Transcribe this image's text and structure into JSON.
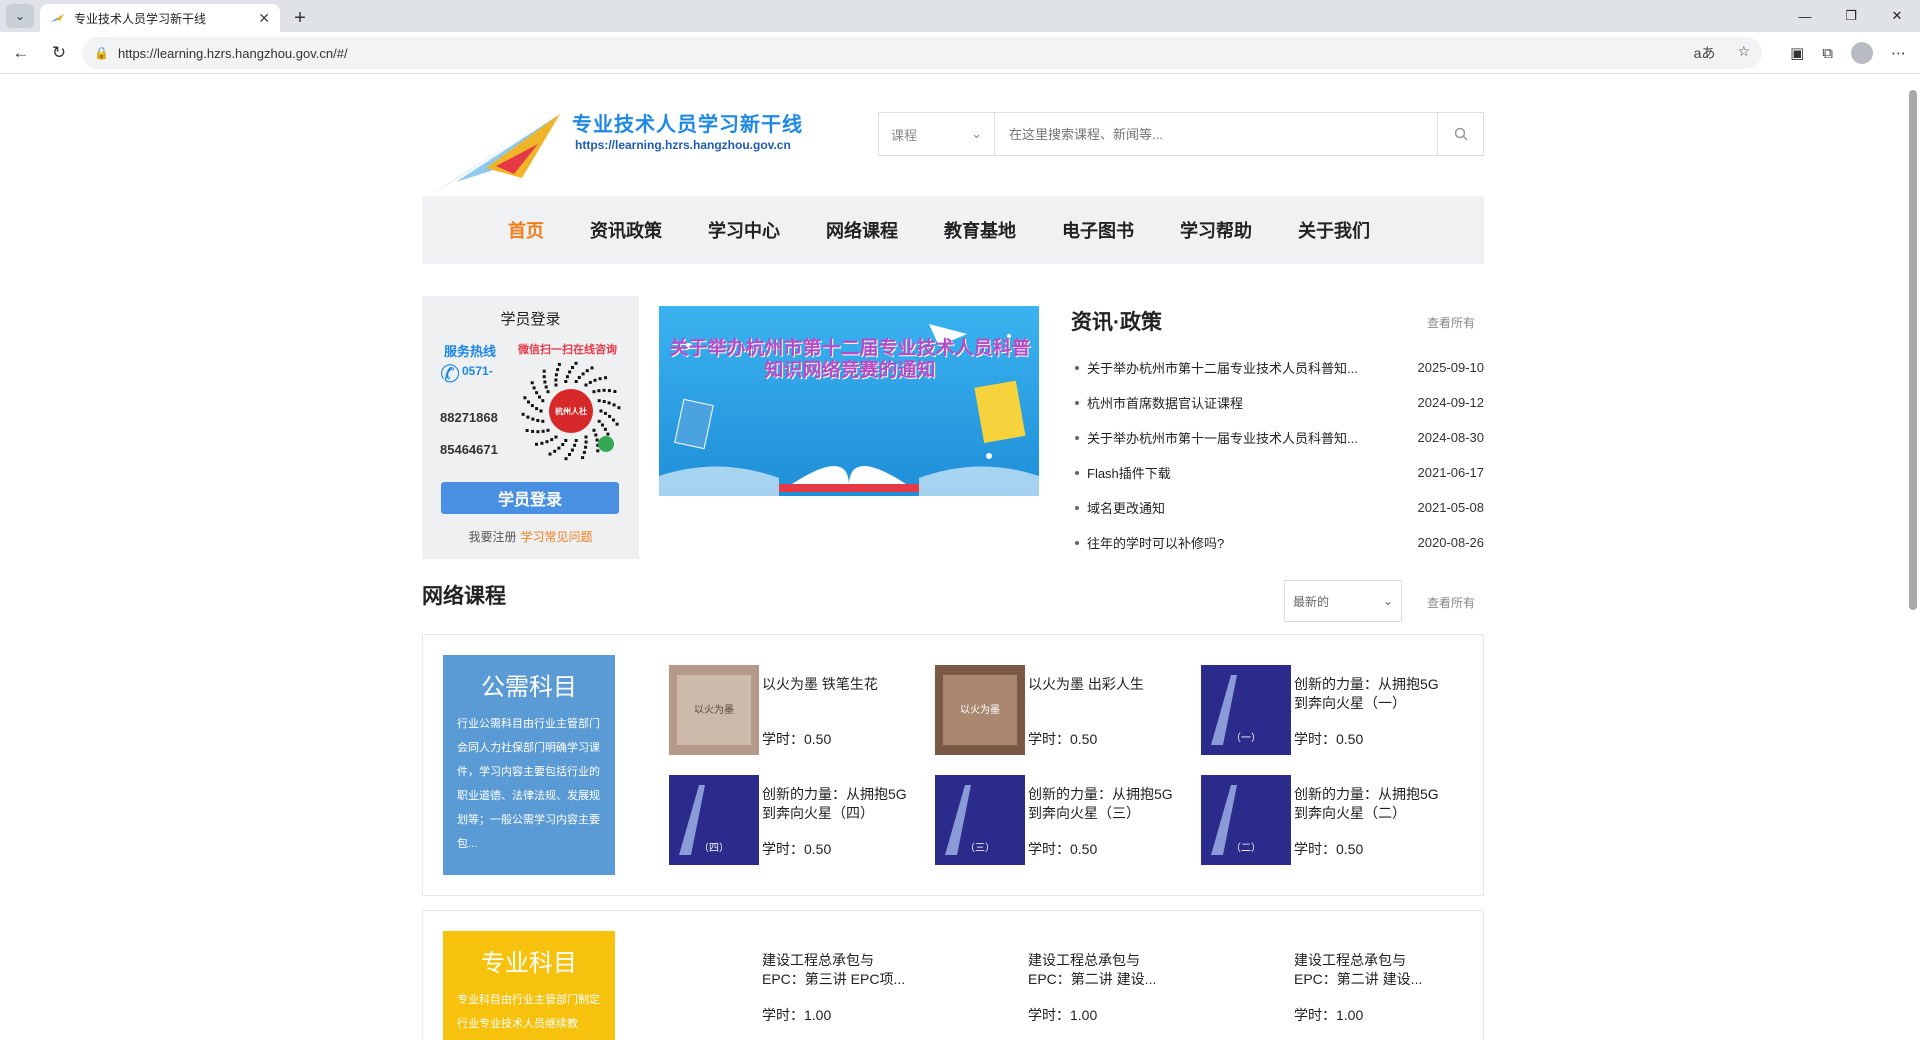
{
  "browser": {
    "tab_title": "专业技术人员学习新干线",
    "url": "https://learning.hzrs.hangzhou.gov.cn/#/"
  },
  "header": {
    "site_name": "专业技术人员学习新干线",
    "site_url": "https://learning.hzrs.hangzhou.gov.cn"
  },
  "search": {
    "category": "课程",
    "placeholder": "在这里搜索课程、新闻等..."
  },
  "nav": [
    {
      "label": "首页",
      "active": true
    },
    {
      "label": "资讯政策"
    },
    {
      "label": "学习中心"
    },
    {
      "label": "网络课程"
    },
    {
      "label": "教育基地"
    },
    {
      "label": "电子图书"
    },
    {
      "label": "学习帮助"
    },
    {
      "label": "关于我们"
    }
  ],
  "login": {
    "title": "学员登录",
    "hotline_label": "服务热线",
    "area_code": "0571-",
    "phone1": "88271868",
    "phone2": "85464671",
    "wechat_hint": "微信扫一扫在线咨询",
    "qr_caption": "杭州人社",
    "button": "学员登录",
    "register": "我要注册",
    "faq": "学习常见问题"
  },
  "banner": {
    "text": "关于举办杭州市第十二届专业技术人员科普知识网络竞赛的通知"
  },
  "news": {
    "title": "资讯·政策",
    "more": "查看所有",
    "items": [
      {
        "title": "关于举办杭州市第十二届专业技术人员科普知...",
        "date": "2025-09-10"
      },
      {
        "title": "杭州市首席数据官认证课程",
        "date": "2024-09-12"
      },
      {
        "title": "关于举办杭州市第十一届专业技术人员科普知...",
        "date": "2024-08-30"
      },
      {
        "title": "Flash插件下载",
        "date": "2021-06-17"
      },
      {
        "title": "域名更改通知",
        "date": "2021-05-08"
      },
      {
        "title": "往年的学时可以补修吗?",
        "date": "2020-08-26"
      }
    ]
  },
  "courses": {
    "title": "网络课程",
    "sort": "最新的",
    "more": "查看所有",
    "public": {
      "title": "公需科目",
      "desc": "行业公需科目由行业主管部门会同人力社保部门明确学习课件，学习内容主要包括行业的职业道德、法律法规、发展规划等；一般公需学习内容主要包...",
      "items": [
        {
          "name": "以火为墨 铁笔生花",
          "hours": "学时：0.50",
          "thumb_text": "以火为墨"
        },
        {
          "name": "以火为墨 出彩人生",
          "hours": "学时：0.50",
          "thumb_text": "以火为墨"
        },
        {
          "name": "创新的力量：从拥抱5G到奔向火星（一）",
          "hours": "学时：0.50",
          "thumb_text": "（一）"
        },
        {
          "name": "创新的力量：从拥抱5G到奔向火星（四）",
          "hours": "学时：0.50",
          "thumb_text": "（四）"
        },
        {
          "name": "创新的力量：从拥抱5G到奔向火星（三）",
          "hours": "学时：0.50",
          "thumb_text": "（三）"
        },
        {
          "name": "创新的力量：从拥抱5G到奔向火星（二）",
          "hours": "学时：0.50",
          "thumb_text": "（二）"
        }
      ]
    },
    "professional": {
      "title": "专业科目",
      "desc": "专业科目由行业主管部门制定行业专业技术人员继续教",
      "items": [
        {
          "name": "建设工程总承包与EPC：第三讲 EPC项...",
          "hours": "学时：1.00"
        },
        {
          "name": "建设工程总承包与EPC：第二讲 建设...",
          "hours": "学时：1.00"
        },
        {
          "name": "建设工程总承包与EPC：第二讲 建设...",
          "hours": "学时：1.00"
        }
      ]
    }
  },
  "colors": {
    "accent_orange": "#f07d1c",
    "brand_blue": "#1e88e5",
    "public_box": "#5b9bd5",
    "professional_box": "#f6c20e"
  }
}
